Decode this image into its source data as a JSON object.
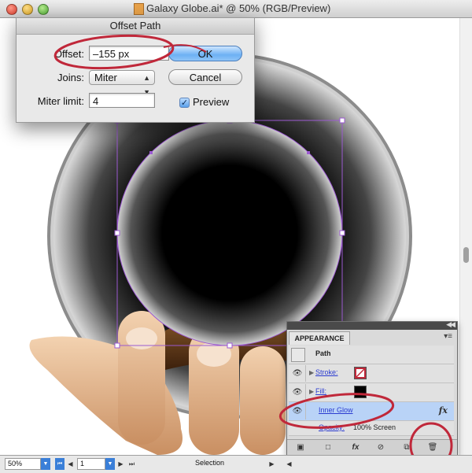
{
  "window": {
    "title": "Galaxy Globe.ai* @ 50% (RGB/Preview)"
  },
  "dialog": {
    "title": "Offset Path",
    "offset_label": "Offset:",
    "offset_value": "–155 px",
    "joins_label": "Joins:",
    "joins_value": "Miter",
    "miter_label": "Miter limit:",
    "miter_value": "4",
    "ok_label": "OK",
    "cancel_label": "Cancel",
    "preview_label": "Preview",
    "preview_checked": true
  },
  "appearance": {
    "tab_label": "APPEARANCE",
    "rows": {
      "path": "Path",
      "stroke": "Stroke:",
      "fill": "Fill:",
      "inner_glow": "Inner Glow",
      "opacity": "Opacity:",
      "opacity_value": "100% Screen"
    },
    "fx_label": "fx"
  },
  "statusbar": {
    "zoom": "50%",
    "artboard": "1",
    "tool": "Selection"
  },
  "colors": {
    "selection": "#9b59d0",
    "annotation": "#c0283a",
    "inner_glow_highlight": "#b9d3f7"
  }
}
